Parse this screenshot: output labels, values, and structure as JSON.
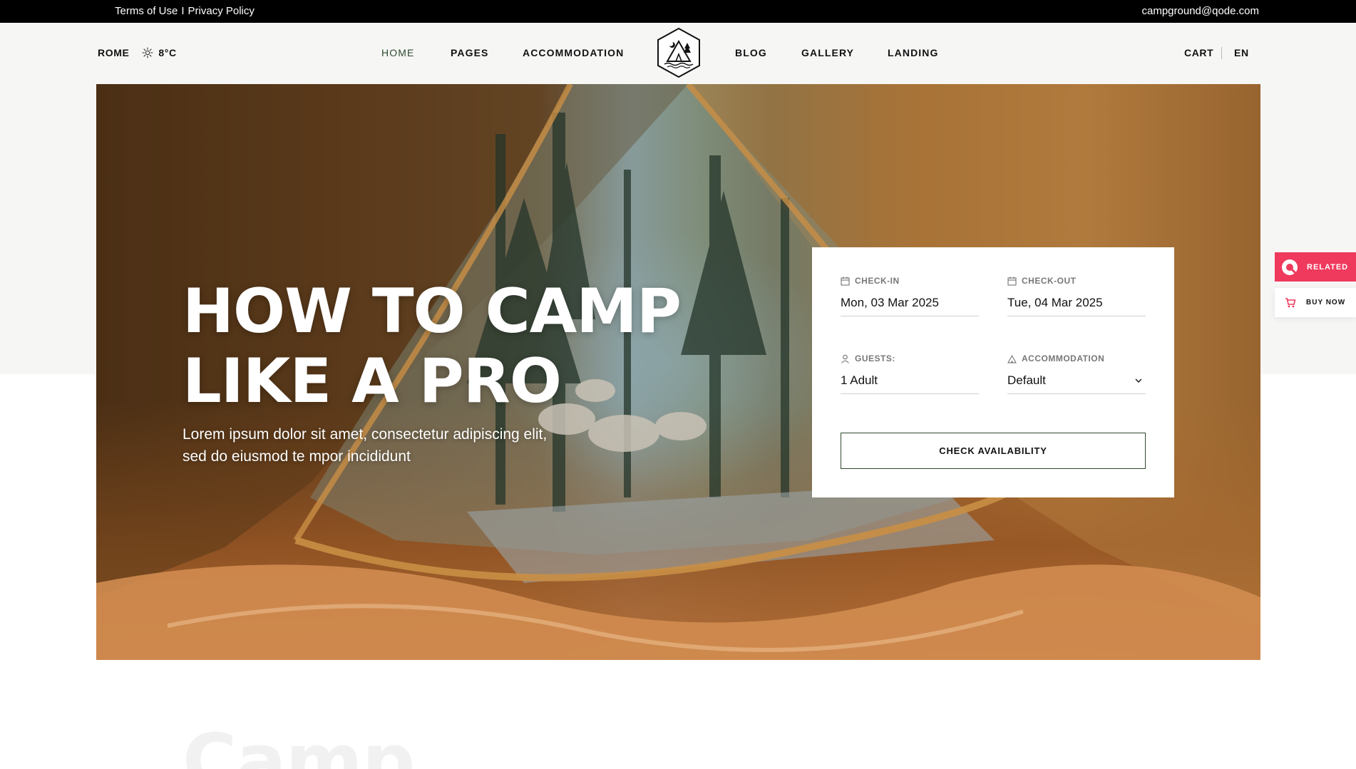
{
  "topbar": {
    "terms": "Terms of Use",
    "divider": "I",
    "privacy": "Privacy Policy",
    "email": "campground@qode.com"
  },
  "header": {
    "city": "ROME",
    "temperature": "8°C",
    "weather_icon": "sun-icon",
    "nav": [
      "HOME",
      "PAGES",
      "ACCOMMODATION",
      "BLOG",
      "GALLERY",
      "LANDING"
    ],
    "active_nav": "HOME",
    "logo_icon": "camp-tent-logo",
    "cart": "CART",
    "language": "EN"
  },
  "hero": {
    "title_line1": "HOW TO CAMP",
    "title_line2": "LIKE A PRO",
    "subtitle": "Lorem ipsum dolor sit amet, consectetur adipiscing elit, sed do eiusmod te mpor incididunt"
  },
  "booking": {
    "checkin": {
      "label": "CHECK-IN",
      "value": "Mon, 03 Mar 2025",
      "icon": "calendar-icon"
    },
    "checkout": {
      "label": "CHECK-OUT",
      "value": "Tue, 04 Mar 2025",
      "icon": "calendar-icon"
    },
    "guests": {
      "label": "GUESTS:",
      "value": "1 Adult",
      "icon": "user-icon"
    },
    "accommodation": {
      "label": "ACCOMMODATION",
      "value": "Default",
      "icon": "tent-icon"
    },
    "button": "CHECK AVAILABILITY"
  },
  "side": {
    "related": "RELATED",
    "buy_now": "BUY NOW"
  },
  "section": {
    "faded_heading": "Camp"
  },
  "colors": {
    "accent_green": "#2f4a2e",
    "related_pink": "#ef3a5d",
    "topbar_bg": "#000000",
    "header_bg": "#f6f6f5"
  }
}
